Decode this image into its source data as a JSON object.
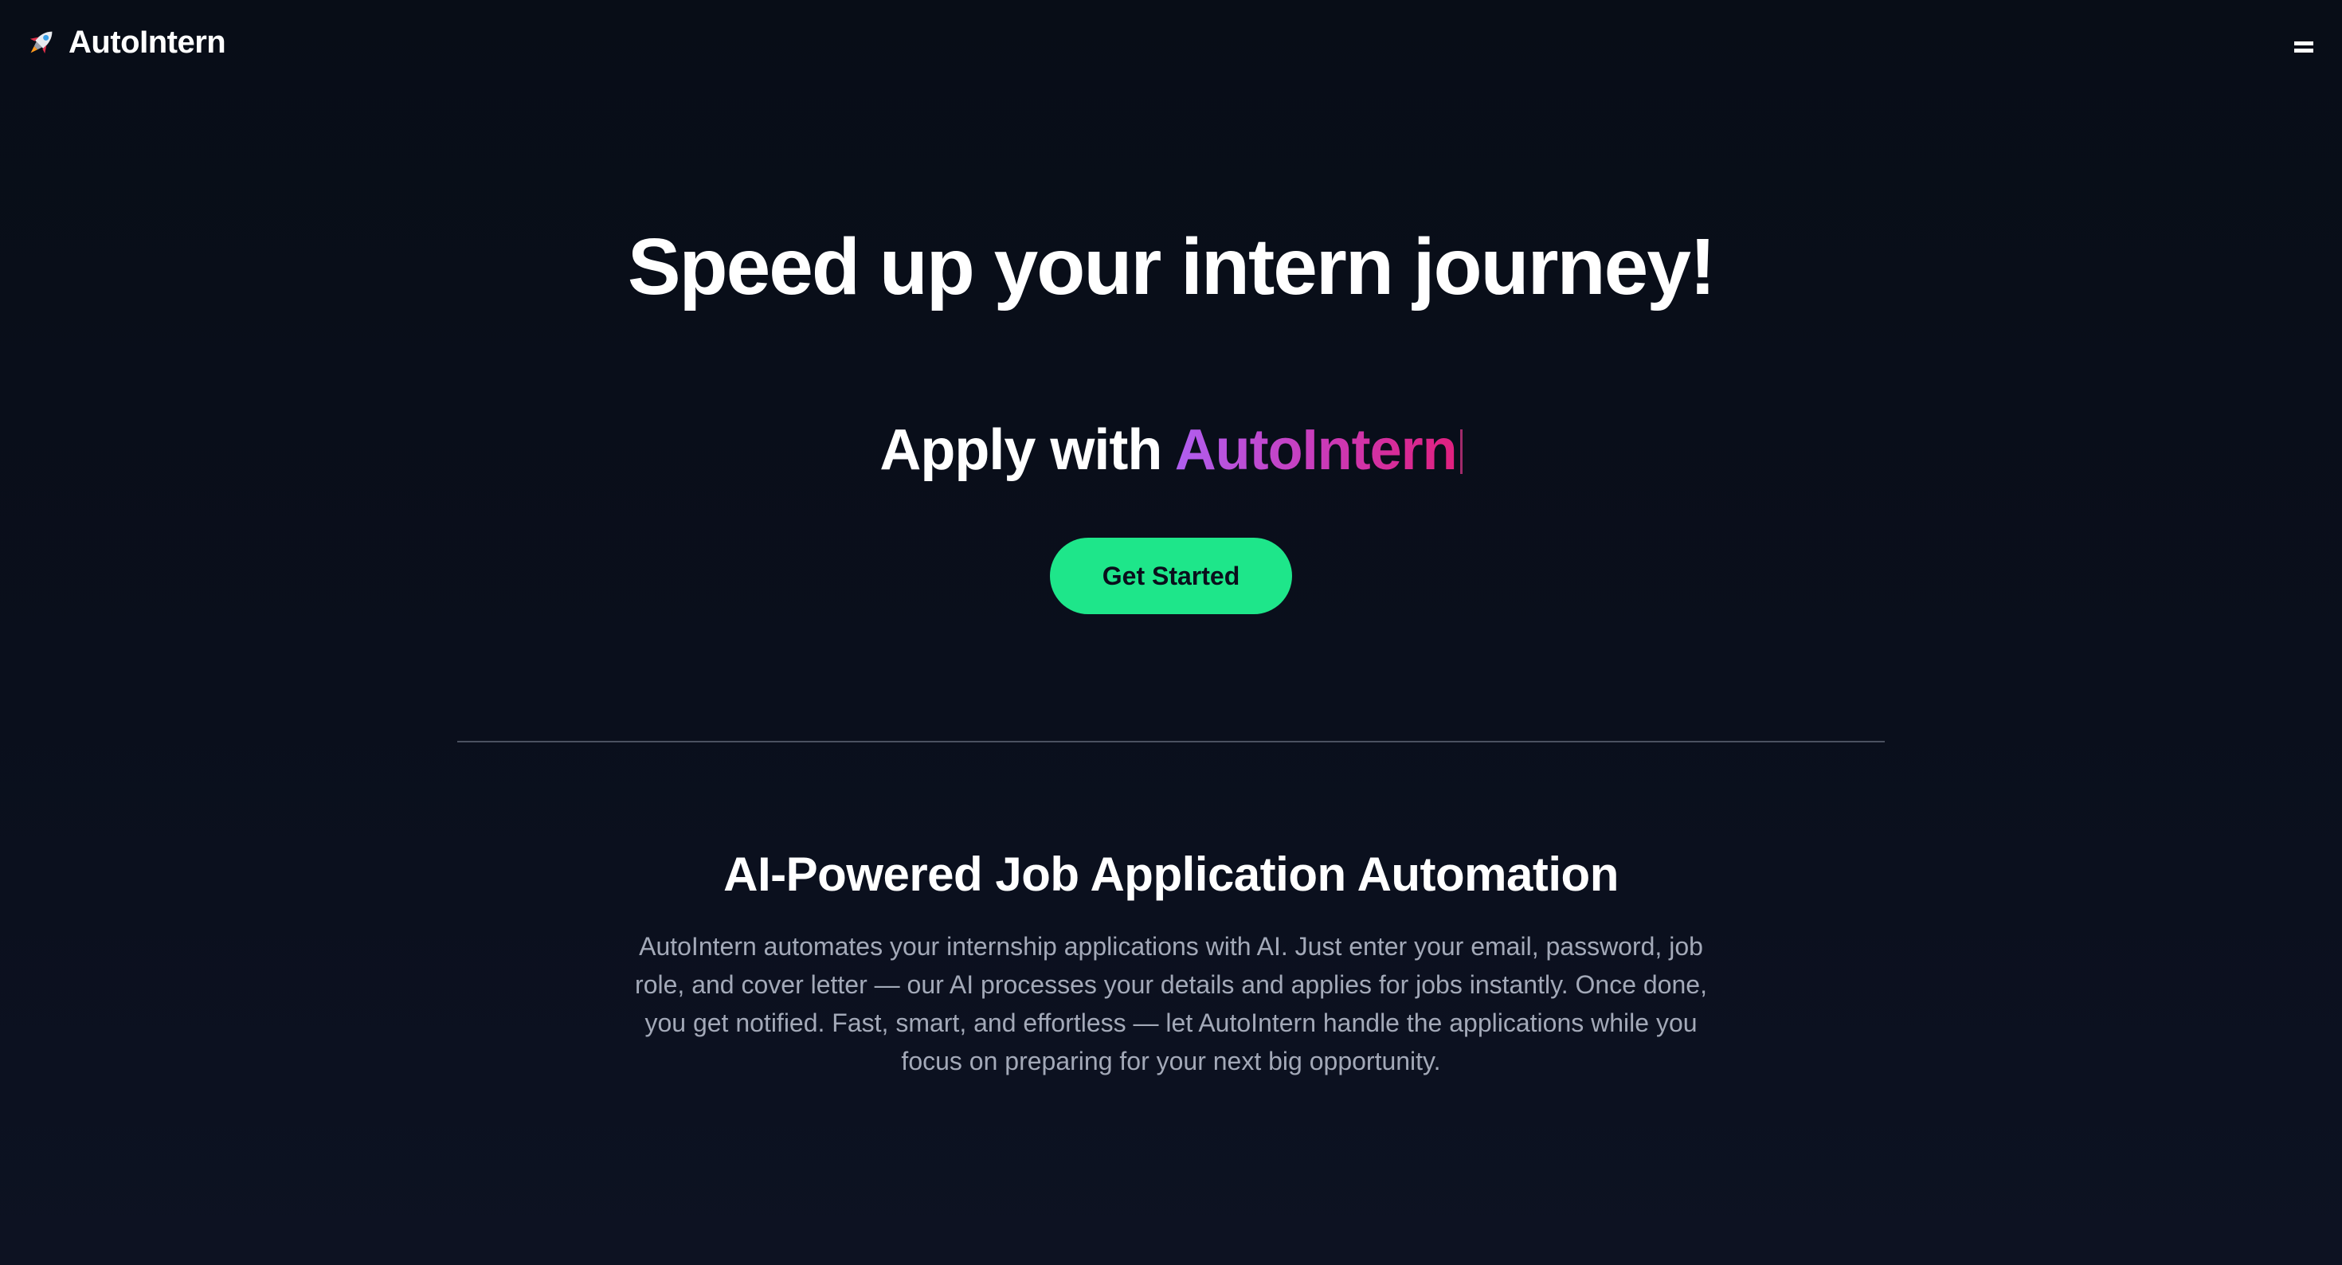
{
  "nav": {
    "brand": "AutoIntern",
    "logo_icon": "rocket-icon",
    "menu_icon": "menu-icon"
  },
  "hero": {
    "title": "Speed up your intern journey!",
    "subtitle_prefix": "Apply with ",
    "subtitle_highlight": "AutoIntern",
    "cta_label": "Get Started"
  },
  "feature": {
    "title": "AI-Powered Job Application Automation",
    "description": "AutoIntern automates your internship applications with AI. Just enter your email, password, job role, and cover letter — our AI processes your details and applies for jobs instantly. Once done, you get notified. Fast, smart, and effortless — let AutoIntern handle the applications while you focus on preparing for your next big opportunity."
  },
  "colors": {
    "background": "#0a0f1c",
    "accent_green": "#1ee68a",
    "gradient_start": "#b05ff0",
    "gradient_end": "#e0207e",
    "muted_text": "#a3a9b8"
  }
}
